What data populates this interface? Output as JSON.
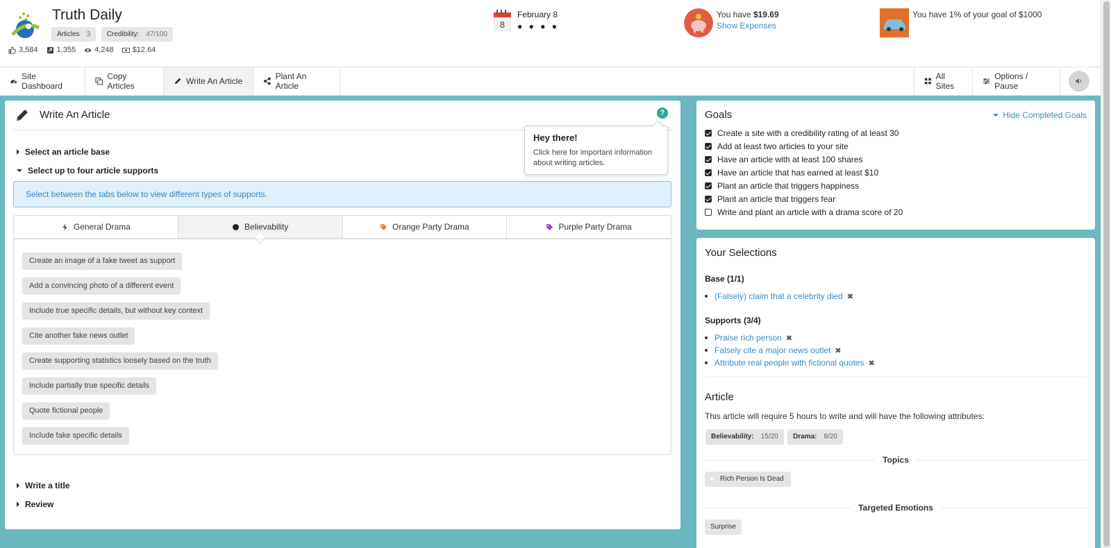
{
  "header": {
    "site_title": "Truth Daily",
    "pills": [
      {
        "label": "Articles",
        "value": "3"
      },
      {
        "label": "Credibility:",
        "value": "47/100"
      }
    ],
    "stats": {
      "likes": "3,584",
      "shares": "1,355",
      "views": "4,248",
      "earnings": "$12.64"
    },
    "date": {
      "day_number": "8",
      "label": "February 8",
      "dots": "● ● ● ●"
    },
    "money": {
      "prefix": "You have ",
      "amount": "$19.69",
      "link": "Show Expenses"
    },
    "goal": {
      "text": "You have 1% of your goal of $1000",
      "percent": 1
    }
  },
  "nav": {
    "left": [
      {
        "label": "Site Dashboard",
        "icon": "dashboard-icon"
      },
      {
        "label": "Copy Articles",
        "icon": "copy-icon"
      },
      {
        "label": "Write An Article",
        "icon": "pencil-icon",
        "active": true
      },
      {
        "label": "Plant An Article",
        "icon": "share-icon"
      }
    ],
    "right": [
      {
        "label": "All Sites",
        "icon": "grid-icon"
      },
      {
        "label": "Options / Pause",
        "icon": "sliders-icon"
      }
    ]
  },
  "write": {
    "title": "Write An Article",
    "help_glyph": "?",
    "sections": {
      "base": "Select an article base",
      "supports": "Select up to four article supports",
      "title": "Write a title",
      "review": "Review"
    },
    "info": "Select between the tabs below to view different types of supports.",
    "tabs": [
      {
        "label": "General Drama"
      },
      {
        "label": "Believability",
        "active": true
      },
      {
        "label": "Orange Party Drama",
        "color": "#e8803a"
      },
      {
        "label": "Purple Party Drama",
        "color": "#a040c0"
      }
    ],
    "supports": [
      "Create an image of a fake tweet as support",
      "Add a convincing photo of a different event",
      "Include true specific details, but without key context",
      "Cite another fake news outlet",
      "Create supporting statistics loosely based on the truth",
      "Include partially true specific details",
      "Quote fictional people",
      "Include fake specific details"
    ]
  },
  "popover": {
    "title": "Hey there!",
    "body": "Click here for important information about writing articles."
  },
  "goals": {
    "title": "Goals",
    "hide_link": "Hide Completed Goals",
    "items": [
      {
        "text": "Create a site with a credibility rating of at least 30",
        "checked": true
      },
      {
        "text": "Add at least two articles to your site",
        "checked": true
      },
      {
        "text": "Have an article with at least 100 shares",
        "checked": true
      },
      {
        "text": "Have an article that has earned at least $10",
        "checked": true
      },
      {
        "text": "Plant an article that triggers happiness",
        "checked": true
      },
      {
        "text": "Plant an article that triggers fear",
        "checked": true
      },
      {
        "text": "Write and plant an article with a drama score of 20",
        "checked": false
      }
    ]
  },
  "selections": {
    "title": "Your Selections",
    "base_heading": "Base (1/1)",
    "base": [
      "(Falsely) claim that a celebrity died"
    ],
    "supports_heading": "Supports (3/4)",
    "supports": [
      "Praise rich person",
      "Falsely cite a major news outlet",
      "Attribute real people with fictional quotes"
    ],
    "remove_glyph": "✖",
    "article_heading": "Article",
    "article_desc": "This article will require 5 hours to write and will have the following attributes:",
    "attributes": [
      {
        "label": "Believability:",
        "value": "15/20"
      },
      {
        "label": "Drama:",
        "value": "8/20"
      }
    ],
    "topics_heading": "Topics",
    "topics": [
      "Rich Person Is Dead"
    ],
    "emotions_heading": "Targeted Emotions",
    "emotions": [
      "Surprise"
    ]
  },
  "colors": {
    "teal_background": "#6bb8bf",
    "link_blue": "#3a8bc4",
    "help_teal": "#27a79c"
  }
}
